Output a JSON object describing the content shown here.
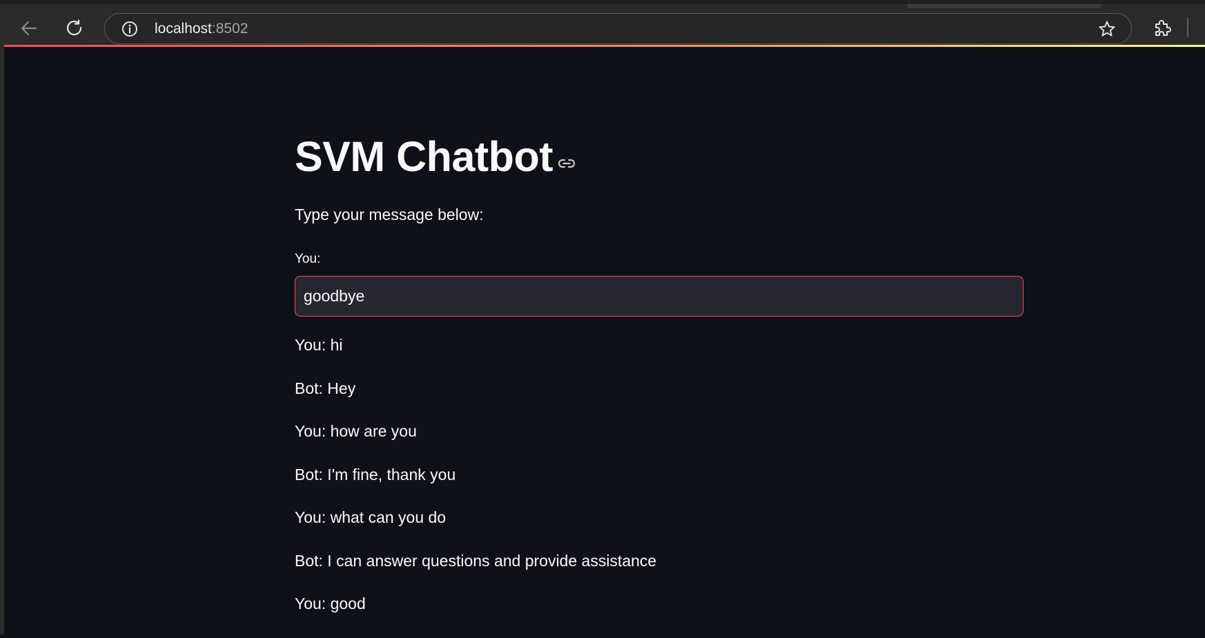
{
  "browser": {
    "url_host": "localhost",
    "url_port": ":8502"
  },
  "page": {
    "title": "SVM Chatbot",
    "subtitle": "Type your message below:",
    "input_label": "You:",
    "input_value": "goodbye"
  },
  "chat": [
    "You: hi",
    "Bot: Hey",
    "You: how are you",
    "Bot: I'm fine, thank you",
    "You: what can you do",
    "Bot: I can answer questions and provide assistance",
    "You: good"
  ],
  "colors": {
    "background": "#0e1117",
    "input_background": "#262730",
    "focus_border": "#ff4b4b",
    "text": "#fafafa"
  },
  "icons": [
    "back-arrow-icon",
    "reload-icon",
    "info-icon",
    "bookmark-star-icon",
    "extensions-icon",
    "link-icon"
  ]
}
